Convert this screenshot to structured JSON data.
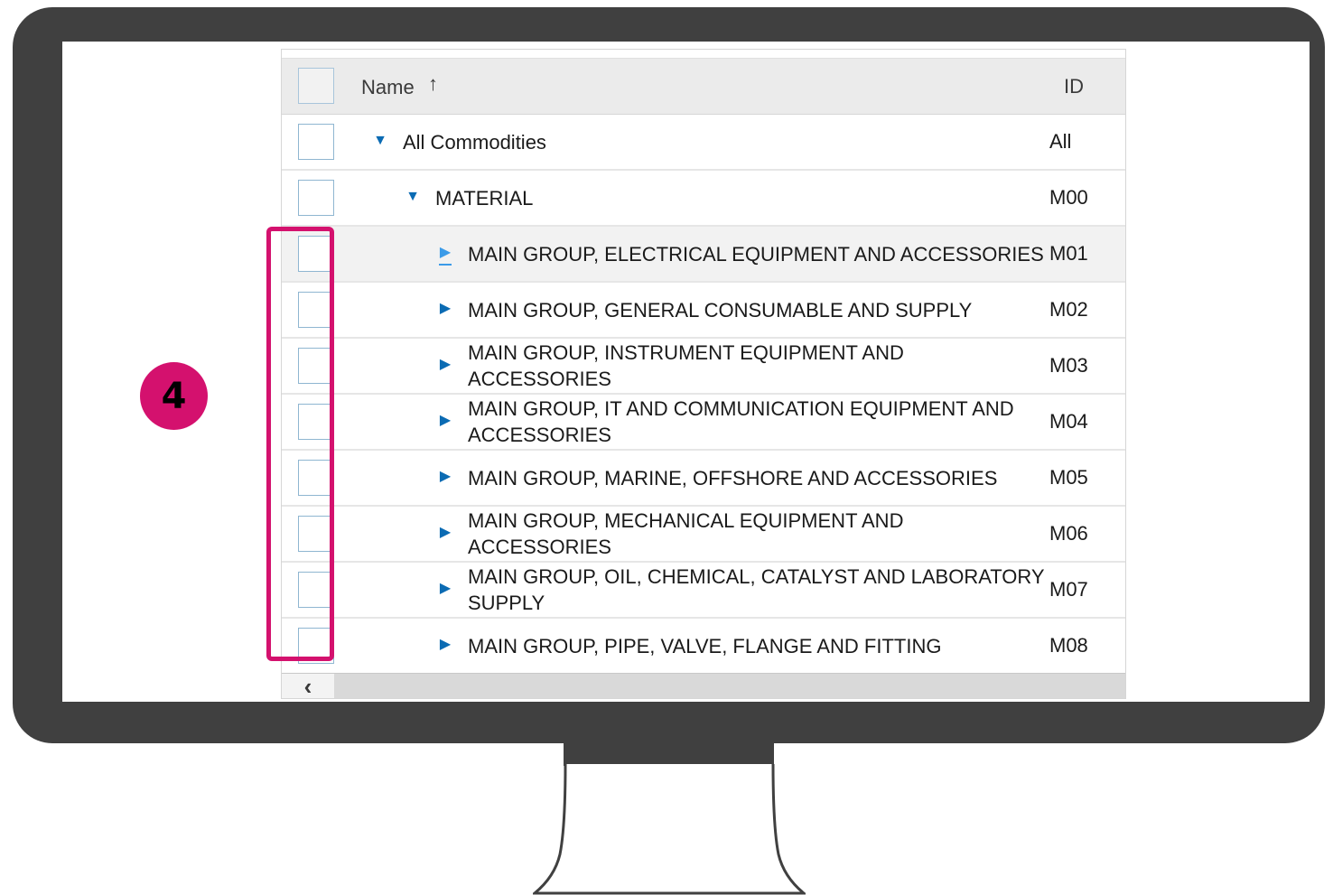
{
  "step_badge": "4",
  "table": {
    "header": {
      "name_label": "Name",
      "sort_icon": "up-arrow-icon",
      "id_label": "ID"
    },
    "rows": [
      {
        "label": "All Commodities",
        "id": "All",
        "level": 0,
        "toggle": "expanded"
      },
      {
        "label": "MATERIAL",
        "id": "M00",
        "level": 1,
        "toggle": "expanded"
      },
      {
        "label": "MAIN GROUP, ELECTRICAL EQUIPMENT AND ACCESSORIES",
        "id": "M01",
        "level": 2,
        "toggle": "collapsed",
        "highlighted": true
      },
      {
        "label": "MAIN GROUP, GENERAL CONSUMABLE AND SUPPLY",
        "id": "M02",
        "level": 2,
        "toggle": "collapsed"
      },
      {
        "label": "MAIN GROUP, INSTRUMENT EQUIPMENT AND ACCESSORIES",
        "id": "M03",
        "level": 2,
        "toggle": "collapsed"
      },
      {
        "label": "MAIN GROUP, IT AND COMMUNICATION EQUIPMENT AND ACCESSORIES",
        "id": "M04",
        "level": 2,
        "toggle": "collapsed"
      },
      {
        "label": "MAIN GROUP, MARINE, OFFSHORE AND ACCESSORIES",
        "id": "M05",
        "level": 2,
        "toggle": "collapsed"
      },
      {
        "label": "MAIN GROUP, MECHANICAL EQUIPMENT AND ACCESSORIES",
        "id": "M06",
        "level": 2,
        "toggle": "collapsed"
      },
      {
        "label": "MAIN GROUP, OIL, CHEMICAL, CATALYST AND LABORATORY SUPPLY",
        "id": "M07",
        "level": 2,
        "toggle": "collapsed"
      },
      {
        "label": "MAIN GROUP, PIPE, VALVE, FLANGE AND FITTING",
        "id": "M08",
        "level": 2,
        "toggle": "collapsed"
      }
    ]
  },
  "scrollbar": {
    "left_button_icon": "chevron-left-icon"
  },
  "colors": {
    "accent": "#d4116e",
    "monitor": "#404040",
    "toggle": "#0b6bb3"
  }
}
